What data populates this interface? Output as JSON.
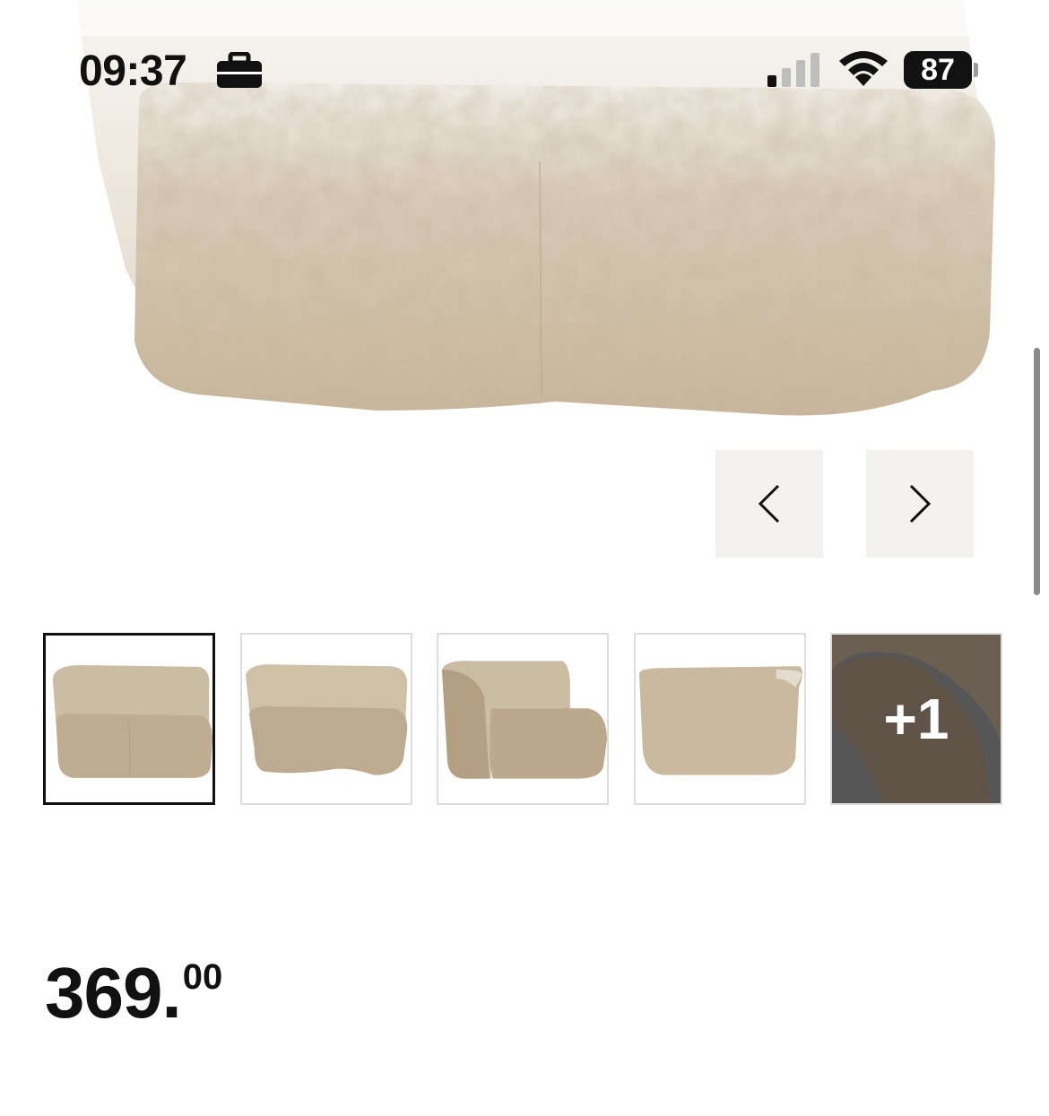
{
  "status_bar": {
    "time": "09:37",
    "battery": "87",
    "icons": [
      "briefcase-icon",
      "cellular-signal-icon",
      "wifi-icon",
      "battery-icon"
    ]
  },
  "carousel": {
    "prev_icon": "chevron-left-icon",
    "next_icon": "chevron-right-icon"
  },
  "thumbnails": {
    "more_label": "+1"
  },
  "product": {
    "price_integer": "369.",
    "price_cents": "00"
  },
  "colors": {
    "fabric": "#cdbfa9",
    "fabric_dark": "#b49f82",
    "nav_button_bg": "#f3f2ee",
    "thumb_active_border": "#111111",
    "thumb_border": "#dddddd"
  }
}
